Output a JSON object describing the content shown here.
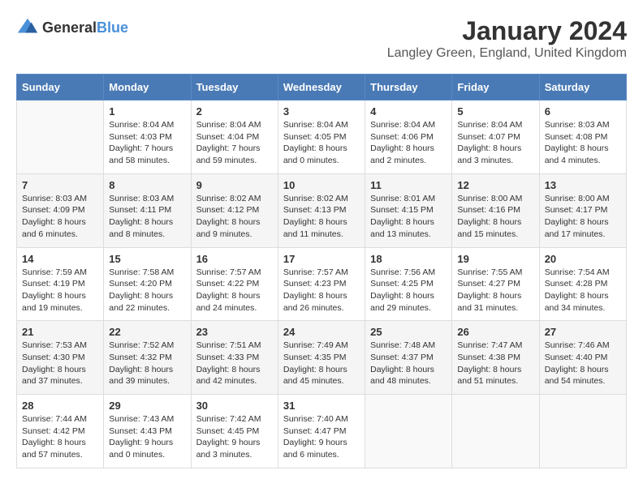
{
  "header": {
    "logo_general": "General",
    "logo_blue": "Blue",
    "title": "January 2024",
    "subtitle": "Langley Green, England, United Kingdom"
  },
  "weekdays": [
    "Sunday",
    "Monday",
    "Tuesday",
    "Wednesday",
    "Thursday",
    "Friday",
    "Saturday"
  ],
  "weeks": [
    [
      {
        "day": "",
        "info": ""
      },
      {
        "day": "1",
        "info": "Sunrise: 8:04 AM\nSunset: 4:03 PM\nDaylight: 7 hours\nand 58 minutes."
      },
      {
        "day": "2",
        "info": "Sunrise: 8:04 AM\nSunset: 4:04 PM\nDaylight: 7 hours\nand 59 minutes."
      },
      {
        "day": "3",
        "info": "Sunrise: 8:04 AM\nSunset: 4:05 PM\nDaylight: 8 hours\nand 0 minutes."
      },
      {
        "day": "4",
        "info": "Sunrise: 8:04 AM\nSunset: 4:06 PM\nDaylight: 8 hours\nand 2 minutes."
      },
      {
        "day": "5",
        "info": "Sunrise: 8:04 AM\nSunset: 4:07 PM\nDaylight: 8 hours\nand 3 minutes."
      },
      {
        "day": "6",
        "info": "Sunrise: 8:03 AM\nSunset: 4:08 PM\nDaylight: 8 hours\nand 4 minutes."
      }
    ],
    [
      {
        "day": "7",
        "info": "Sunrise: 8:03 AM\nSunset: 4:09 PM\nDaylight: 8 hours\nand 6 minutes."
      },
      {
        "day": "8",
        "info": "Sunrise: 8:03 AM\nSunset: 4:11 PM\nDaylight: 8 hours\nand 8 minutes."
      },
      {
        "day": "9",
        "info": "Sunrise: 8:02 AM\nSunset: 4:12 PM\nDaylight: 8 hours\nand 9 minutes."
      },
      {
        "day": "10",
        "info": "Sunrise: 8:02 AM\nSunset: 4:13 PM\nDaylight: 8 hours\nand 11 minutes."
      },
      {
        "day": "11",
        "info": "Sunrise: 8:01 AM\nSunset: 4:15 PM\nDaylight: 8 hours\nand 13 minutes."
      },
      {
        "day": "12",
        "info": "Sunrise: 8:00 AM\nSunset: 4:16 PM\nDaylight: 8 hours\nand 15 minutes."
      },
      {
        "day": "13",
        "info": "Sunrise: 8:00 AM\nSunset: 4:17 PM\nDaylight: 8 hours\nand 17 minutes."
      }
    ],
    [
      {
        "day": "14",
        "info": "Sunrise: 7:59 AM\nSunset: 4:19 PM\nDaylight: 8 hours\nand 19 minutes."
      },
      {
        "day": "15",
        "info": "Sunrise: 7:58 AM\nSunset: 4:20 PM\nDaylight: 8 hours\nand 22 minutes."
      },
      {
        "day": "16",
        "info": "Sunrise: 7:57 AM\nSunset: 4:22 PM\nDaylight: 8 hours\nand 24 minutes."
      },
      {
        "day": "17",
        "info": "Sunrise: 7:57 AM\nSunset: 4:23 PM\nDaylight: 8 hours\nand 26 minutes."
      },
      {
        "day": "18",
        "info": "Sunrise: 7:56 AM\nSunset: 4:25 PM\nDaylight: 8 hours\nand 29 minutes."
      },
      {
        "day": "19",
        "info": "Sunrise: 7:55 AM\nSunset: 4:27 PM\nDaylight: 8 hours\nand 31 minutes."
      },
      {
        "day": "20",
        "info": "Sunrise: 7:54 AM\nSunset: 4:28 PM\nDaylight: 8 hours\nand 34 minutes."
      }
    ],
    [
      {
        "day": "21",
        "info": "Sunrise: 7:53 AM\nSunset: 4:30 PM\nDaylight: 8 hours\nand 37 minutes."
      },
      {
        "day": "22",
        "info": "Sunrise: 7:52 AM\nSunset: 4:32 PM\nDaylight: 8 hours\nand 39 minutes."
      },
      {
        "day": "23",
        "info": "Sunrise: 7:51 AM\nSunset: 4:33 PM\nDaylight: 8 hours\nand 42 minutes."
      },
      {
        "day": "24",
        "info": "Sunrise: 7:49 AM\nSunset: 4:35 PM\nDaylight: 8 hours\nand 45 minutes."
      },
      {
        "day": "25",
        "info": "Sunrise: 7:48 AM\nSunset: 4:37 PM\nDaylight: 8 hours\nand 48 minutes."
      },
      {
        "day": "26",
        "info": "Sunrise: 7:47 AM\nSunset: 4:38 PM\nDaylight: 8 hours\nand 51 minutes."
      },
      {
        "day": "27",
        "info": "Sunrise: 7:46 AM\nSunset: 4:40 PM\nDaylight: 8 hours\nand 54 minutes."
      }
    ],
    [
      {
        "day": "28",
        "info": "Sunrise: 7:44 AM\nSunset: 4:42 PM\nDaylight: 8 hours\nand 57 minutes."
      },
      {
        "day": "29",
        "info": "Sunrise: 7:43 AM\nSunset: 4:43 PM\nDaylight: 9 hours\nand 0 minutes."
      },
      {
        "day": "30",
        "info": "Sunrise: 7:42 AM\nSunset: 4:45 PM\nDaylight: 9 hours\nand 3 minutes."
      },
      {
        "day": "31",
        "info": "Sunrise: 7:40 AM\nSunset: 4:47 PM\nDaylight: 9 hours\nand 6 minutes."
      },
      {
        "day": "",
        "info": ""
      },
      {
        "day": "",
        "info": ""
      },
      {
        "day": "",
        "info": ""
      }
    ]
  ]
}
